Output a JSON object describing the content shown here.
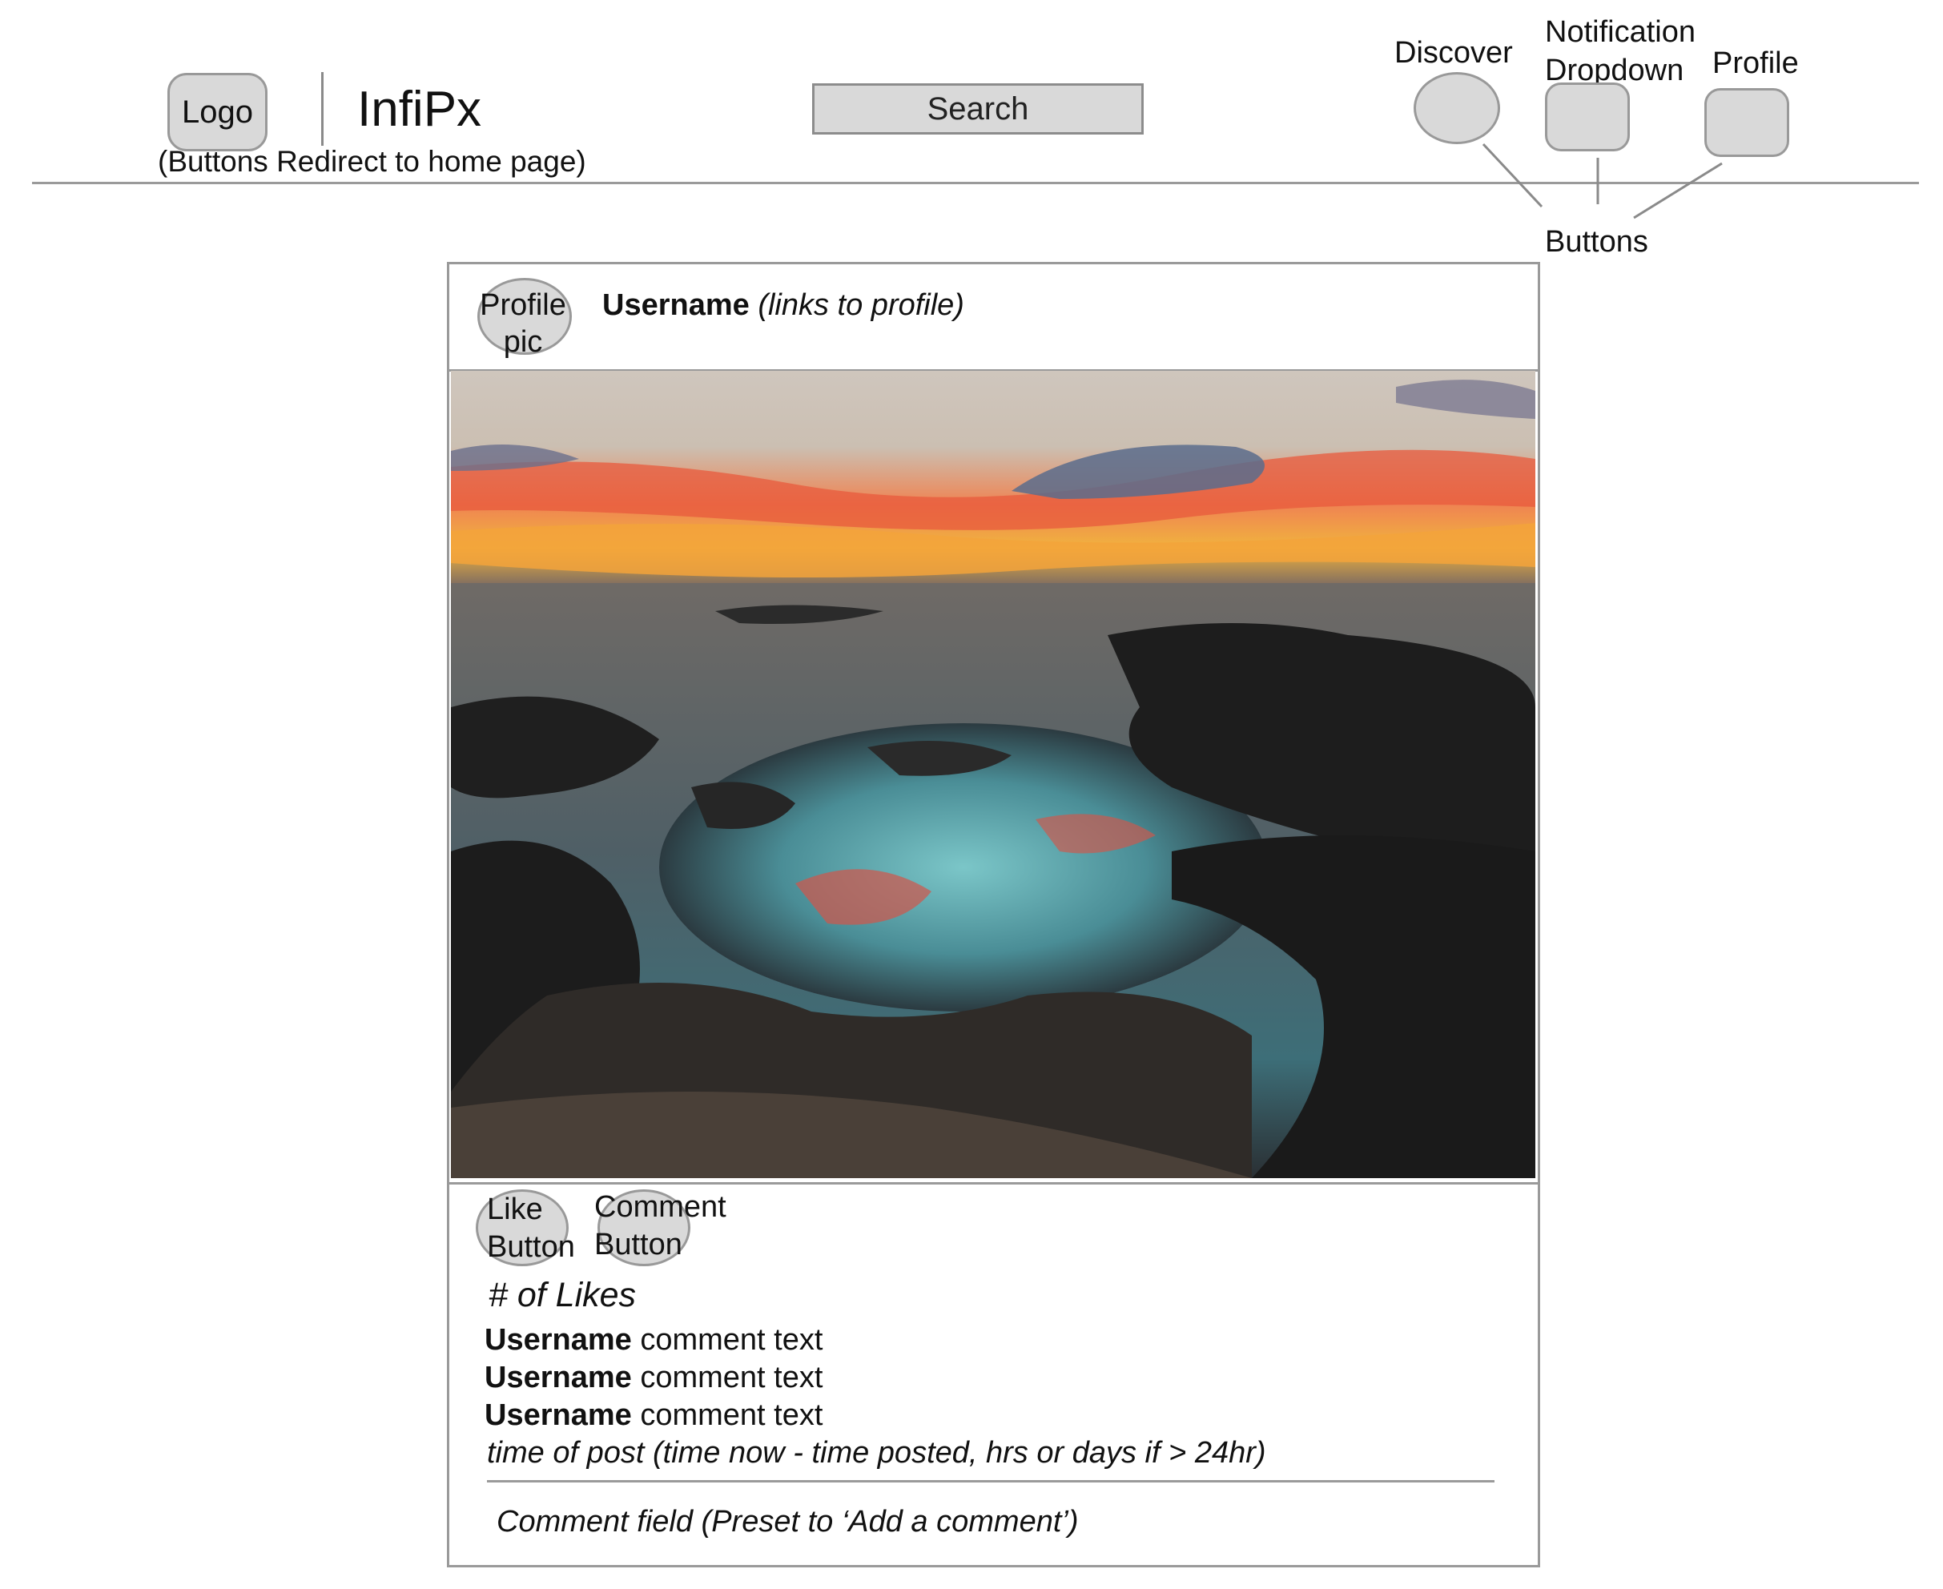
{
  "header": {
    "logo_label": "Logo",
    "app_title": "InfiPx",
    "redirect_note": "(Buttons Redirect to home page)",
    "search_label": "Search",
    "nav": {
      "discover_label": "Discover",
      "notification_label_line1": "Notification",
      "notification_label_line2": "Dropdown",
      "profile_label": "Profile",
      "buttons_label": "Buttons"
    }
  },
  "post": {
    "profile_pic_line1": "Profile",
    "profile_pic_line2": "pic",
    "username": "Username",
    "username_note": "(links to profile)",
    "like_line1": "Like",
    "like_line2": "Button",
    "comment_line1": "Comment",
    "comment_line2": "Button",
    "likes_count": "# of Likes",
    "comments": [
      {
        "username": "Username",
        "text": " comment text"
      },
      {
        "username": "Username",
        "text": " comment text"
      },
      {
        "username": "Username",
        "text": " comment text"
      }
    ],
    "time_of_post": "time of post (time now - time posted, hrs or days if > 24hr)",
    "comment_field_value": "Comment field (Preset to ‘Add a comment’)"
  },
  "colors": {
    "wireframe_fill": "#d9d9d9",
    "wireframe_stroke": "#999999"
  }
}
